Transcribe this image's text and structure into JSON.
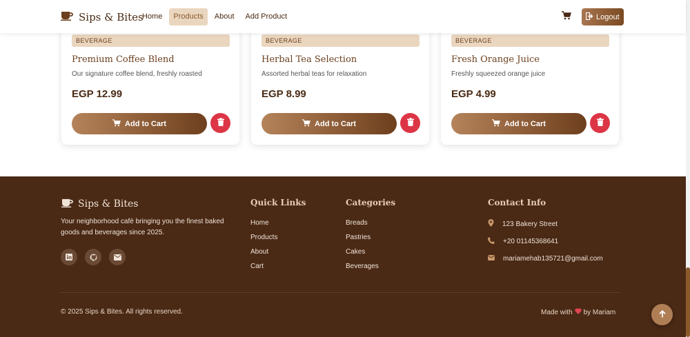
{
  "navbar": {
    "brand": "Sips & Bites",
    "links": [
      "Home",
      "Products",
      "About",
      "Add Product"
    ],
    "active_link": "Products",
    "logout_label": "Logout"
  },
  "products": [
    {
      "category": "BEVERAGE",
      "name": "Premium Coffee Blend",
      "description": "Our signature coffee blend, freshly roasted",
      "price": "EGP 12.99",
      "add_label": "Add to Cart"
    },
    {
      "category": "BEVERAGE",
      "name": "Herbal Tea Selection",
      "description": "Assorted herbal teas for relaxation",
      "price": "EGP 8.99",
      "add_label": "Add to Cart"
    },
    {
      "category": "BEVERAGE",
      "name": "Fresh Orange Juice",
      "description": "Freshly squeezed orange juice",
      "price": "EGP 4.99",
      "add_label": "Add to Cart"
    }
  ],
  "footer": {
    "brand": "Sips & Bites",
    "tagline": "Your neighborhood café bringing you the finest baked goods and beverages since 2025.",
    "socials": [
      "linkedin-icon",
      "github-icon",
      "envelope-icon"
    ],
    "quick_links": {
      "heading": "Quick Links",
      "items": [
        "Home",
        "Products",
        "About",
        "Cart"
      ]
    },
    "categories": {
      "heading": "Categories",
      "items": [
        "Breads",
        "Pastries",
        "Cakes",
        "Beverages"
      ]
    },
    "contact": {
      "heading": "Contact Info",
      "address": "123 Bakery Street",
      "phone": "+20 01145368641",
      "email": "mariamehab135721@gmail.com"
    },
    "copyright": "© 2025 Sips & Bites. All rights reserved.",
    "made_with_prefix": "Made with",
    "made_with_suffix": "by Mariam"
  },
  "colors": {
    "brand_brown": "#4a2915",
    "accent_tan": "#ead6bf",
    "danger": "#dc3545"
  }
}
